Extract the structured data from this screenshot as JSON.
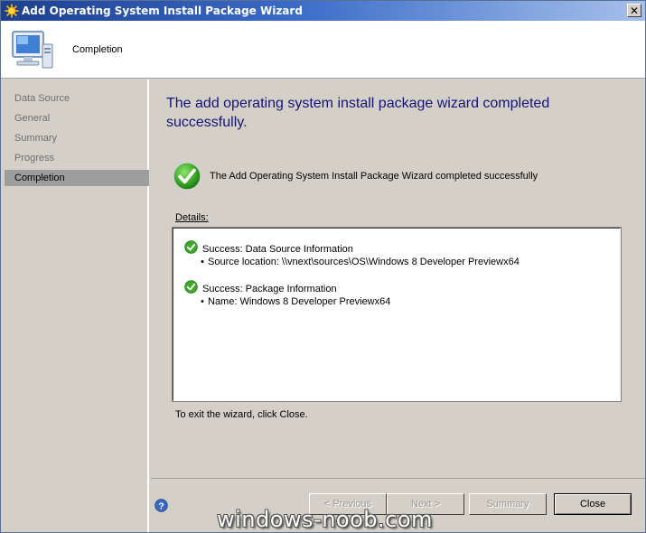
{
  "window": {
    "title": "Add Operating System Install Package Wizard",
    "close_glyph": "✕"
  },
  "header": {
    "page_name": "Completion"
  },
  "nav": {
    "items": [
      {
        "label": "Data Source",
        "active": false
      },
      {
        "label": "General",
        "active": false
      },
      {
        "label": "Summary",
        "active": false
      },
      {
        "label": "Progress",
        "active": false
      },
      {
        "label": "Completion",
        "active": true
      }
    ]
  },
  "main": {
    "heading": "The add operating system install package wizard completed successfully.",
    "status_text": "The Add Operating System Install Package Wizard completed successfully",
    "details_label": "Details:",
    "details": [
      {
        "title": "Success: Data Source Information",
        "item": "Source location: \\\\vnext\\sources\\OS\\Windows 8 Developer Previewx64"
      },
      {
        "title": "Success: Package Information",
        "item": "Name: Windows 8 Developer Previewx64"
      }
    ],
    "exit_text": "To exit the wizard, click Close."
  },
  "buttons": {
    "previous": "< Previous",
    "next": "Next >",
    "summary": "Summary",
    "close": "Close"
  },
  "watermark": "windows-noob.com",
  "colors": {
    "heading": "#14137a",
    "title_bar": "#1d3f8f",
    "success": "#2e9a1e"
  }
}
